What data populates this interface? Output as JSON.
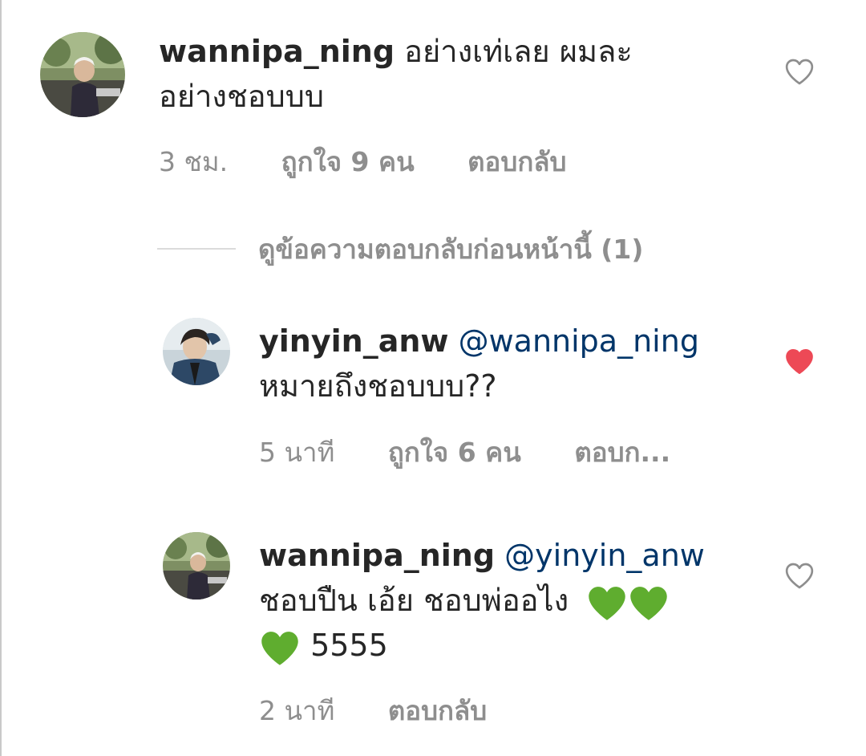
{
  "comments": [
    {
      "username": "wannipa_ning",
      "text_line1": " อย่างเท่เลย ผมละ",
      "text_line2": "อย่างชอบบบ",
      "time": "3 ชม.",
      "likes": "ถูกใจ 9 คน",
      "reply": "ตอบกลับ",
      "liked": false
    }
  ],
  "view_replies_label": "ดูข้อความตอบกลับก่อนหน้านี้ (1)",
  "replies": [
    {
      "username": "yinyin_anw",
      "mention": "@wannipa_ning",
      "text_line2": "หมายถึงชอบบบ??",
      "time": "5 นาที",
      "likes": "ถูกใจ 6 คน",
      "reply": "ตอบก...",
      "liked": true
    },
    {
      "username": "wannipa_ning",
      "mention": "@yinyin_anw",
      "text_line2": "ชอบปืน เอ้ย ชอบพ่ออไง",
      "text_line3": " 5555",
      "time": "2 นาที",
      "reply": "ตอบกลับ",
      "liked": false
    }
  ],
  "colors": {
    "heart_liked": "#ed4956",
    "heart_outline": "#8e8e8e",
    "meta_text": "#8e8e8e",
    "mention": "#003569",
    "green_heart": "#5fad2f"
  },
  "icons": {
    "like": "heart-icon",
    "green_heart": "green-heart-emoji"
  }
}
